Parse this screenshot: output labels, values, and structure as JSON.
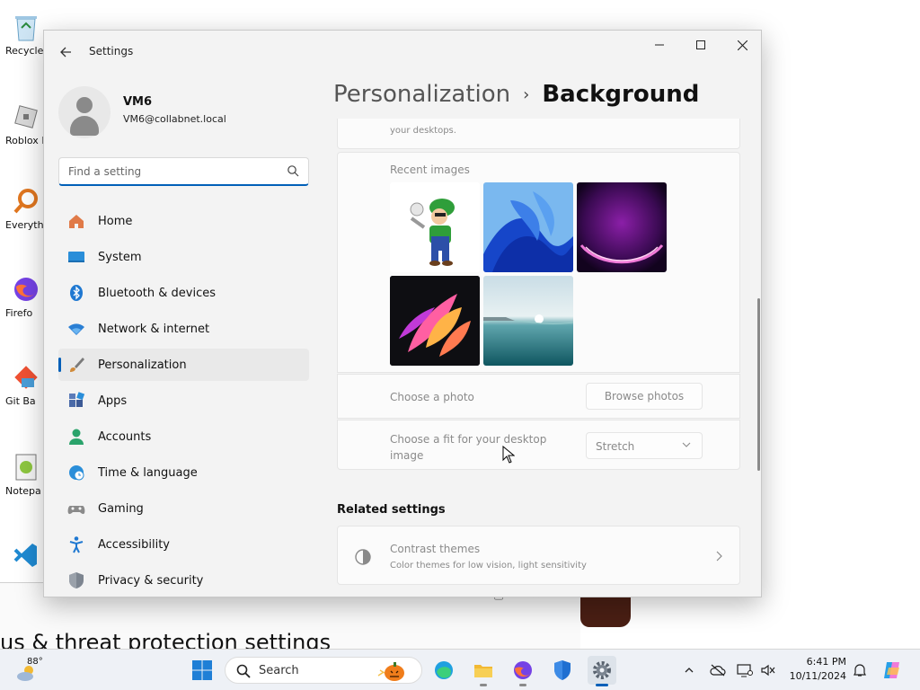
{
  "desktop": {
    "icons": [
      {
        "label": "Recycle",
        "icon": "recycle-bin-icon"
      },
      {
        "label": "Roblox P",
        "icon": "roblox-icon"
      },
      {
        "label": "Everyth",
        "icon": "everything-search-icon"
      },
      {
        "label": "Firefo",
        "icon": "firefox-icon"
      },
      {
        "label": "Git Ba",
        "icon": "git-bash-icon"
      },
      {
        "label": "Notepa",
        "icon": "notepad-plus-plus-icon"
      },
      {
        "label": "",
        "icon": "vscode-icon"
      }
    ],
    "background_window_caption": "us & threat protection settings"
  },
  "window": {
    "title": "Settings",
    "back_icon": "back-arrow-icon"
  },
  "profile": {
    "name": "VM6",
    "email": "VM6@collabnet.local"
  },
  "search": {
    "placeholder": "Find a setting",
    "icon": "search-icon"
  },
  "nav": {
    "items": [
      {
        "label": "Home",
        "icon": "home-icon"
      },
      {
        "label": "System",
        "icon": "system-icon"
      },
      {
        "label": "Bluetooth & devices",
        "icon": "bluetooth-icon"
      },
      {
        "label": "Network & internet",
        "icon": "wifi-icon"
      },
      {
        "label": "Personalization",
        "icon": "brush-icon",
        "active": true
      },
      {
        "label": "Apps",
        "icon": "apps-icon"
      },
      {
        "label": "Accounts",
        "icon": "accounts-icon"
      },
      {
        "label": "Time & language",
        "icon": "globe-clock-icon"
      },
      {
        "label": "Gaming",
        "icon": "gamepad-icon"
      },
      {
        "label": "Accessibility",
        "icon": "accessibility-icon"
      },
      {
        "label": "Privacy & security",
        "icon": "shield-icon"
      }
    ]
  },
  "content": {
    "breadcrumb_parent": "Personalization",
    "breadcrumb_separator": "›",
    "breadcrumb_current": "Background",
    "top_card_text": "your desktops.",
    "recent_images_label": "Recent images",
    "recent_images": [
      {
        "name": "cartoon character wallpaper"
      },
      {
        "name": "blue bloom wallpaper"
      },
      {
        "name": "purple glow wallpaper"
      },
      {
        "name": "colorful petals wallpaper"
      },
      {
        "name": "lake horizon wallpaper"
      }
    ],
    "choose_photo_label": "Choose a photo",
    "browse_button": "Browse photos",
    "fit_label": "Choose a fit for your desktop image",
    "fit_value": "Stretch",
    "related_heading": "Related settings",
    "contrast_title": "Contrast themes",
    "contrast_subtitle": "Color themes for low vision, light sensitivity"
  },
  "taskbar": {
    "weather_temp": "88°",
    "search_text": "Search",
    "apps": [
      {
        "name": "start-button",
        "icon": "windows-logo-icon"
      },
      {
        "name": "edge",
        "icon": "edge-icon"
      },
      {
        "name": "file-explorer",
        "icon": "folder-icon"
      },
      {
        "name": "firefox",
        "icon": "firefox-icon"
      },
      {
        "name": "defender",
        "icon": "shield-icon"
      },
      {
        "name": "settings",
        "icon": "gear-icon",
        "active": true
      }
    ],
    "clock_time": "6:41 PM",
    "clock_date": "10/11/2024"
  },
  "colors": {
    "accent": "#005fb8",
    "window_bg": "#f3f3f3",
    "card_bg": "#fbfbfb",
    "taskbar_bg": "#eef1f6"
  }
}
